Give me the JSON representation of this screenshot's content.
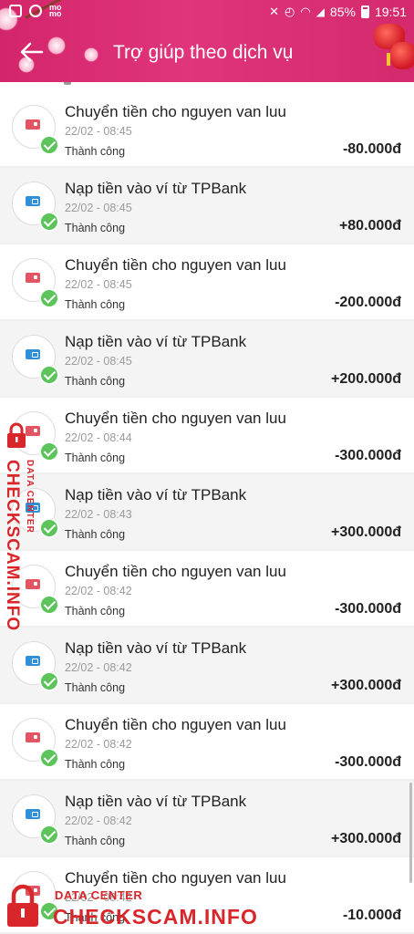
{
  "status_bar": {
    "left_icons": [
      "image-icon",
      "instagram-icon",
      "momo-icon",
      "blossom-icon"
    ],
    "battery": "85%",
    "time": "19:51"
  },
  "header": {
    "title": "Trợ giúp theo dịch vụ",
    "back_icon": "arrow-left-icon",
    "background_color": "#d8306f"
  },
  "transactions": [
    {
      "title": "Chuyển tiền cho nguyen van luu",
      "time": "22/02 - 08:45",
      "status": "Thành công",
      "amount": "-80.000đ",
      "type": "transfer-out"
    },
    {
      "title": "Nạp tiền vào ví từ TPBank",
      "time": "22/02 - 08:45",
      "status": "Thành công",
      "amount": "+80.000đ",
      "type": "top-up"
    },
    {
      "title": "Chuyển tiền cho nguyen van luu",
      "time": "22/02 - 08:45",
      "status": "Thành công",
      "amount": "-200.000đ",
      "type": "transfer-out"
    },
    {
      "title": "Nạp tiền vào ví từ TPBank",
      "time": "22/02 - 08:45",
      "status": "Thành công",
      "amount": "+200.000đ",
      "type": "top-up"
    },
    {
      "title": "Chuyển tiền cho nguyen van luu",
      "time": "22/02 - 08:44",
      "status": "Thành công",
      "amount": "-300.000đ",
      "type": "transfer-out"
    },
    {
      "title": "Nạp tiền vào ví từ TPBank",
      "time": "22/02 - 08:43",
      "status": "Thành công",
      "amount": "+300.000đ",
      "type": "top-up"
    },
    {
      "title": "Chuyển tiền cho nguyen van luu",
      "time": "22/02 - 08:42",
      "status": "Thành công",
      "amount": "-300.000đ",
      "type": "transfer-out"
    },
    {
      "title": "Nạp tiền vào ví từ TPBank",
      "time": "22/02 - 08:42",
      "status": "Thành công",
      "amount": "+300.000đ",
      "type": "top-up"
    },
    {
      "title": "Chuyển tiền cho nguyen van luu",
      "time": "22/02 - 08:42",
      "status": "Thành công",
      "amount": "-300.000đ",
      "type": "transfer-out"
    },
    {
      "title": "Nạp tiền vào ví từ TPBank",
      "time": "22/02 - 08:42",
      "status": "Thành công",
      "amount": "+300.000đ",
      "type": "top-up"
    },
    {
      "title": "Chuyển tiền cho nguyen van luu",
      "time": "22/02 - 08:42",
      "status": "Thành công",
      "amount": "-10.000đ",
      "type": "transfer-out"
    }
  ],
  "watermark": {
    "main": "CHECKSCAM.INFO",
    "sub": "DATA CENTER",
    "color": "#d8262a"
  },
  "colors": {
    "success_check": "#5cc45a",
    "transfer_icon": "#e05561",
    "topup_icon": "#2f8fd8"
  }
}
